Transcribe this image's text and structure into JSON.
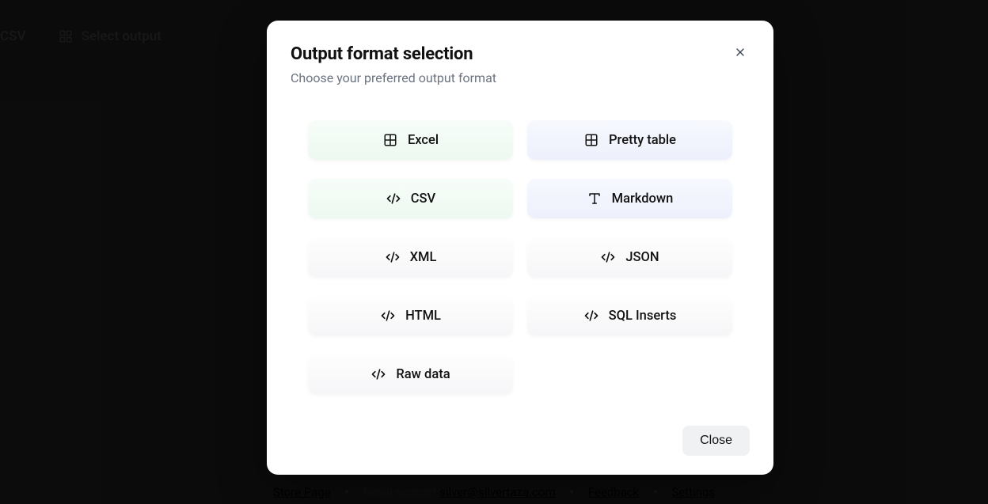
{
  "toolbar": {
    "csv_label": "CSV",
    "select_output_label": "Select output"
  },
  "modal": {
    "title": "Output format selection",
    "subtitle": "Choose your preferred output format",
    "close_button": "Close",
    "options": [
      {
        "label": "Excel",
        "icon": "grid",
        "tint": "green"
      },
      {
        "label": "Pretty table",
        "icon": "grid",
        "tint": "blue"
      },
      {
        "label": "CSV",
        "icon": "code",
        "tint": "green"
      },
      {
        "label": "Markdown",
        "icon": "type",
        "tint": "blue"
      },
      {
        "label": "XML",
        "icon": "code",
        "tint": "gray"
      },
      {
        "label": "JSON",
        "icon": "code",
        "tint": "gray"
      },
      {
        "label": "HTML",
        "icon": "code",
        "tint": "gray"
      },
      {
        "label": "SQL Inserts",
        "icon": "code",
        "tint": "gray"
      },
      {
        "label": "Raw data",
        "icon": "code",
        "tint": "gray"
      }
    ]
  },
  "footer": {
    "store_page": "Store Page",
    "email_support_label": "Email support",
    "email": "silver@silvertaza.com",
    "feedback": "Feedback",
    "settings": "Settings"
  }
}
